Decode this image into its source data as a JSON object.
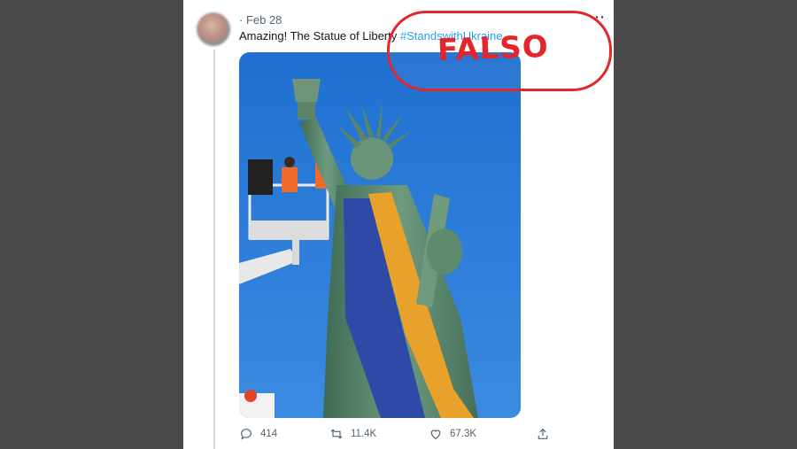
{
  "tweet": {
    "timestamp": "· Feb 28",
    "text": "Amazing! The Statue of Liberty ",
    "hashtag": "#StandswithUkraine",
    "more_icon": "more-dots-icon"
  },
  "actions": {
    "reply_count": "414",
    "retweet_count": "11.4K",
    "like_count": "67.3K",
    "icons": [
      "reply-icon",
      "retweet-icon",
      "like-icon",
      "share-icon"
    ]
  },
  "stamp": {
    "label": "FALSO",
    "color": "#e2262c"
  },
  "colors": {
    "accent": "#1d9bf0",
    "sky": "#2f7fd6",
    "statue": "#5c8a70",
    "flag_blue": "#2e4aa6",
    "flag_yellow": "#e8a12a"
  }
}
